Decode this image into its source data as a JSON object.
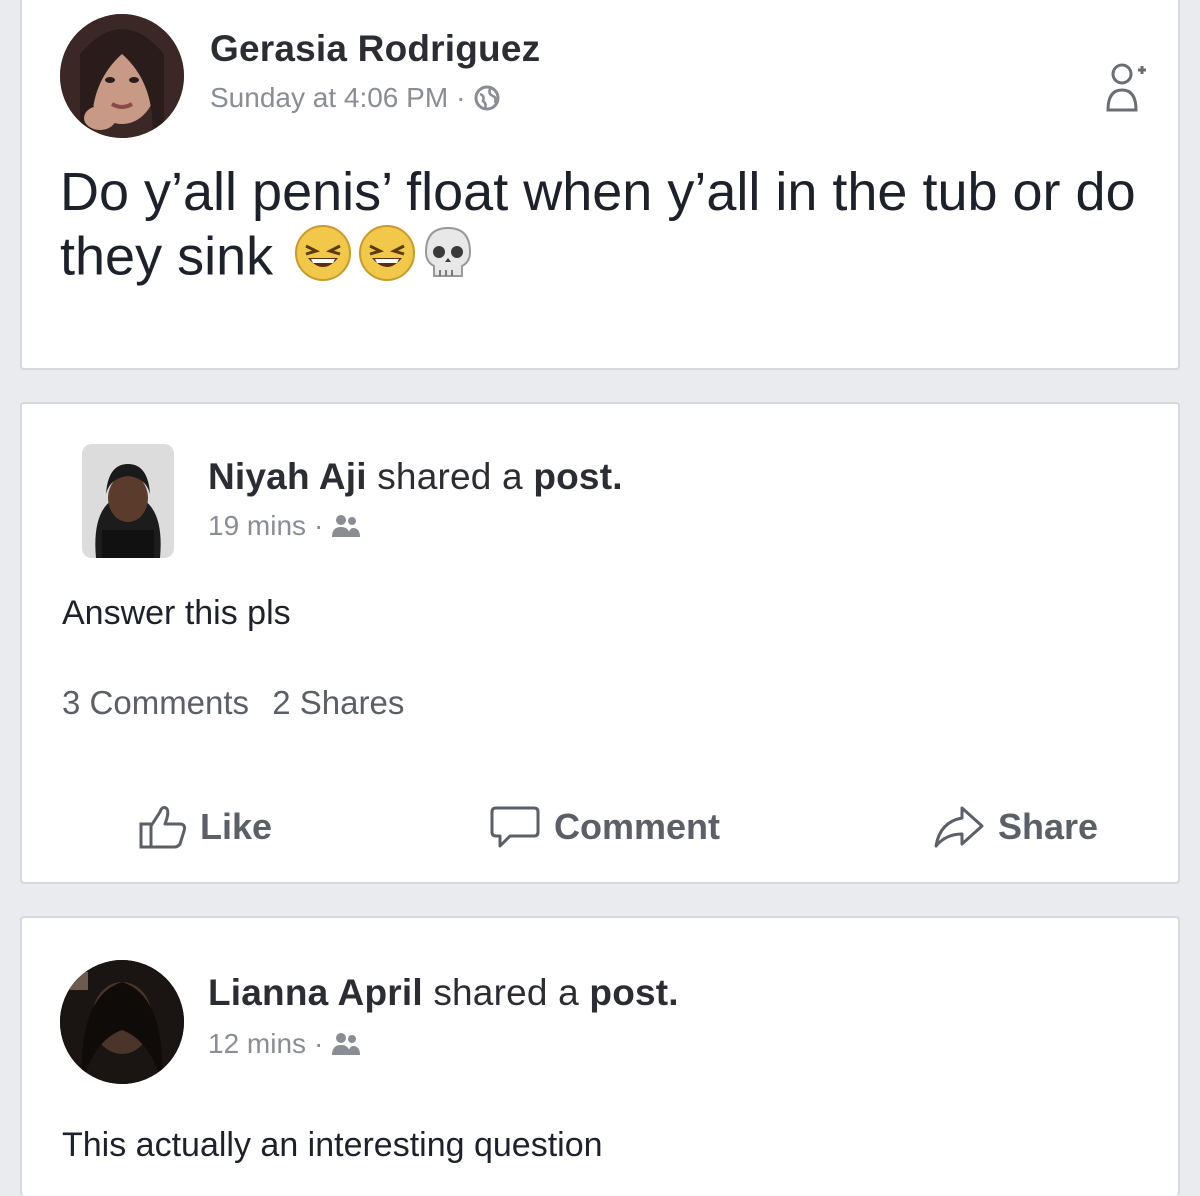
{
  "original_post": {
    "author": "Gerasia Rodriguez",
    "timestamp": "Sunday at 4:06 PM",
    "separator": "·",
    "privacy_icon": "globe-icon",
    "text": "Do y’all penis’ float when y’all in the tub or do they sink",
    "emojis": [
      "grinning-squinting-face",
      "grinning-squinting-face",
      "skull"
    ]
  },
  "shared_posts": [
    {
      "author": "Niyah Aji",
      "action": "shared a",
      "object": "post.",
      "timestamp": "19 mins",
      "separator": "·",
      "privacy_icon": "friends-icon",
      "text": "Answer this pls",
      "comments_count": "3 Comments",
      "shares_count": "2 Shares",
      "actions": {
        "like": "Like",
        "comment": "Comment",
        "share": "Share"
      }
    },
    {
      "author": "Lianna April",
      "action": "shared a",
      "object": "post.",
      "timestamp": "12 mins",
      "separator": "·",
      "privacy_icon": "friends-icon",
      "text": "This actually an interesting question"
    }
  ],
  "colors": {
    "background": "#e9ebee",
    "card": "#ffffff",
    "text": "#1d2129",
    "meta": "#8a8d93",
    "action": "#5b5f66"
  }
}
